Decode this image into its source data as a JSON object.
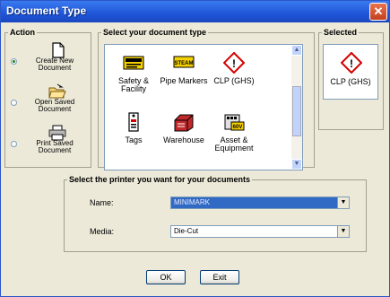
{
  "window": {
    "title": "Document Type",
    "close_glyph": "✕"
  },
  "action": {
    "legend": "Action",
    "options": [
      {
        "label": "Create New Document",
        "icon": "blank-document-icon",
        "selected": true
      },
      {
        "label": "Open Saved Document",
        "icon": "open-folder-icon",
        "selected": false
      },
      {
        "label": "Print Saved Document",
        "icon": "printer-icon",
        "selected": false
      }
    ]
  },
  "document_types": {
    "legend": "Select your document type",
    "items": [
      {
        "label": "Safety & Facility",
        "icon": "caution-sign-icon"
      },
      {
        "label": "Pipe Markers",
        "icon": "steam-pipe-marker-icon",
        "icon_text": "STEAM"
      },
      {
        "label": "CLP (GHS)",
        "icon": "ghs-exclamation-icon",
        "icon_text": "!"
      },
      {
        "label": "Tags",
        "icon": "tag-icon"
      },
      {
        "label": "Warehouse",
        "icon": "warehouse-box-icon"
      },
      {
        "label": "Asset & Equipment",
        "icon": "equipment-icon",
        "icon_text": "60V"
      }
    ],
    "scroll_up": "▲",
    "scroll_down": "▼"
  },
  "selected": {
    "legend": "Selected",
    "label": "CLP (GHS)",
    "icon": "ghs-exclamation-icon",
    "icon_text": "!"
  },
  "printer": {
    "legend": "Select the printer you want for your documents",
    "name_label": "Name:",
    "name_value": "MINIMARK",
    "media_label": "Media:",
    "media_value": "Die-Cut",
    "dropdown_arrow": "▼"
  },
  "buttons": {
    "ok": "OK",
    "exit": "Exit"
  },
  "colors": {
    "title_bar": "#1f55d8",
    "highlight": "#316ac5",
    "ghs_red": "#d40000",
    "caution_yellow": "#f5d000"
  }
}
